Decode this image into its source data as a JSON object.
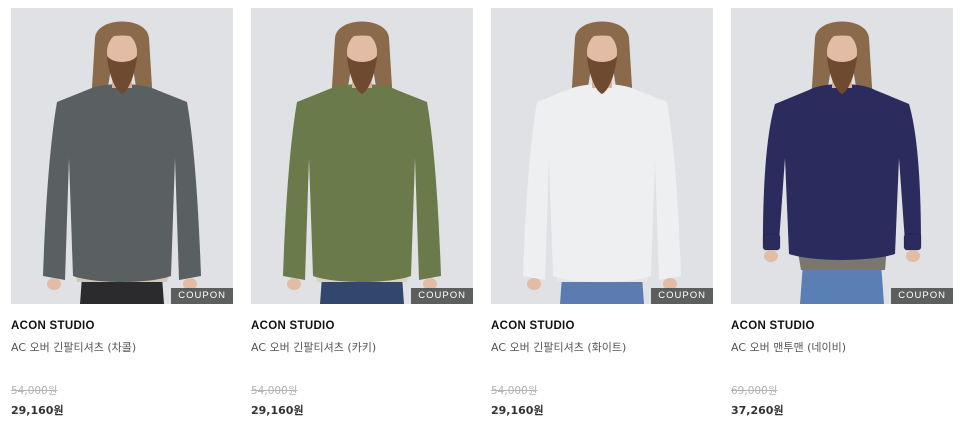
{
  "products": [
    {
      "brand": "ACON STUDIO",
      "name": "AC 오버 긴팔티셔츠 (차콜)",
      "original_price": "54,000원",
      "sale_price": "29,160원",
      "badge": "COUPON",
      "shirt_color": "#5a5f61",
      "pants_color": "#2b2b2e",
      "layer_color": "#cfc7b8",
      "style": "tee"
    },
    {
      "brand": "ACON STUDIO",
      "name": "AC 오버 긴팔티셔츠 (카키)",
      "original_price": "54,000원",
      "sale_price": "29,160원",
      "badge": "COUPON",
      "shirt_color": "#6b7a4a",
      "pants_color": "#33466b",
      "layer_color": "#d8d2c4",
      "style": "tee"
    },
    {
      "brand": "ACON STUDIO",
      "name": "AC 오버 긴팔티셔츠 (화이트)",
      "original_price": "54,000원",
      "sale_price": "29,160원",
      "badge": "COUPON",
      "shirt_color": "#eeeff0",
      "pants_color": "#5c7bb0",
      "layer_color": "#e6e6e6",
      "style": "tee"
    },
    {
      "brand": "ACON STUDIO",
      "name": "AC 오버 맨투맨 (네이비)",
      "original_price": "69,000원",
      "sale_price": "37,260원",
      "badge": "COUPON",
      "shirt_color": "#2c2b5e",
      "pants_color": "#5a7fb4",
      "layer_color": "#7a7670",
      "style": "sweat"
    }
  ]
}
